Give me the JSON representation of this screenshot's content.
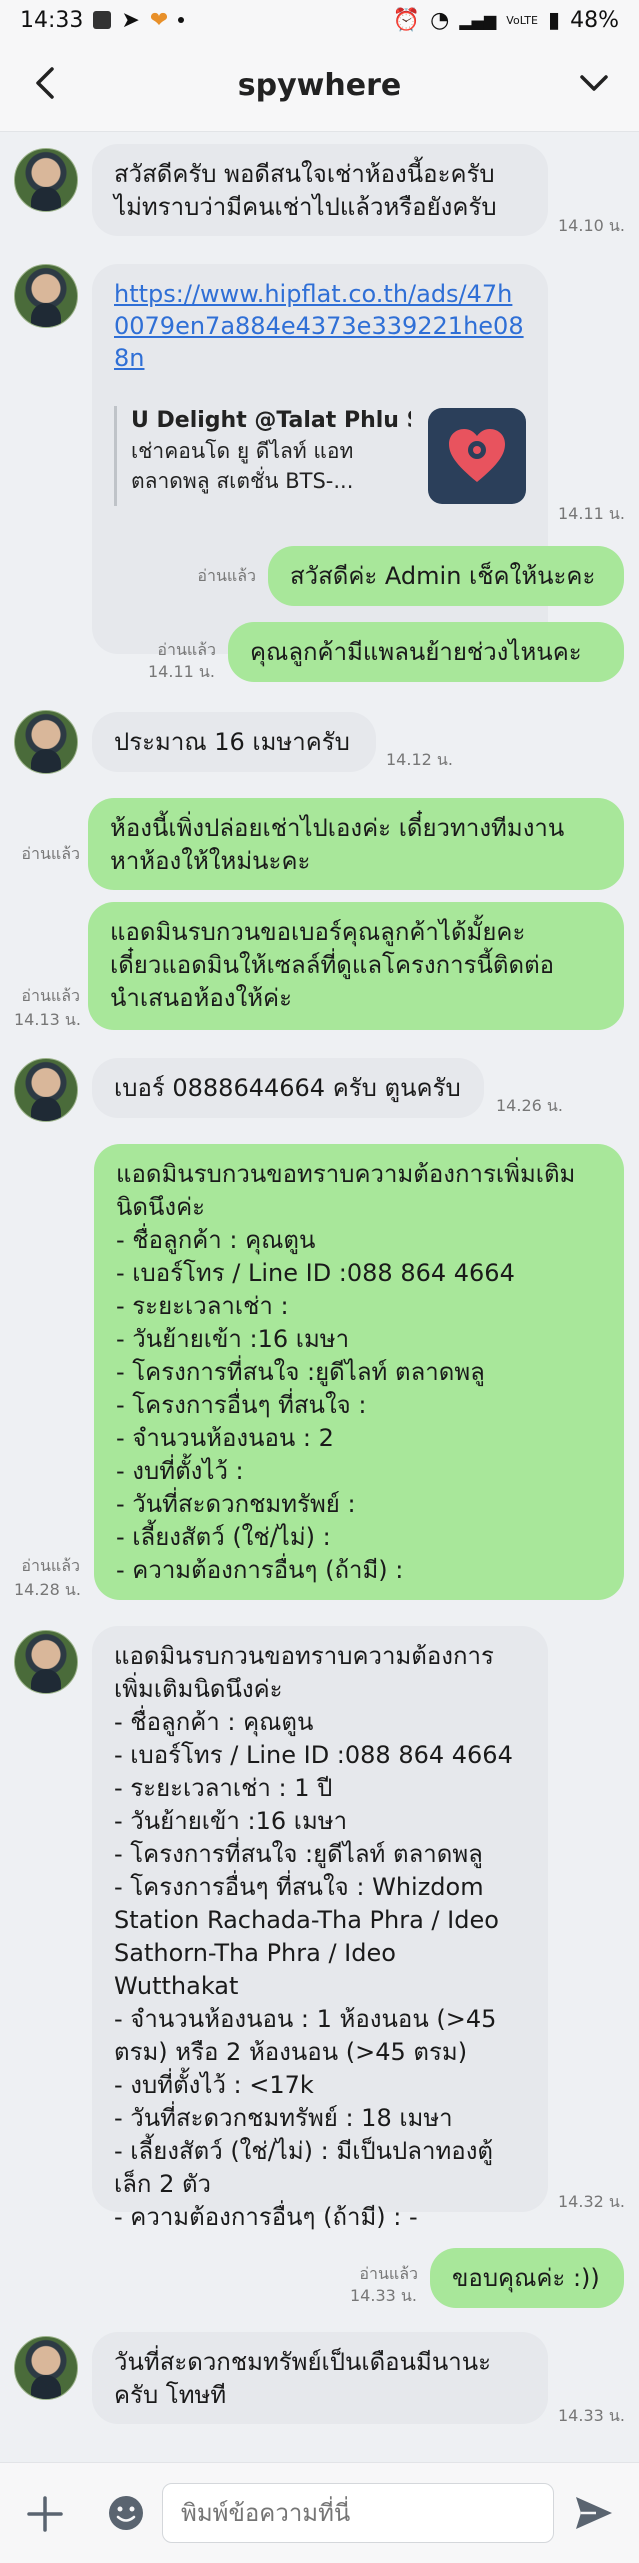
{
  "status_bar": {
    "time": "14:33",
    "battery": "48%",
    "network": "VoLTE"
  },
  "header": {
    "title": "spywhere"
  },
  "messages": [
    {
      "text": "สวัสดีครับ พอดีสนใจเช่าห้องนี้อะครับ\nไม่ทราบว่ามีคนเช่าไปแล้วหรือยังครับ",
      "time": "14.10 น."
    },
    {
      "url": "https://www.hipflat.co.th/ads/47h0079en7a884e4373e339221he088n",
      "preview_title": "U Delight @Talat Phlu St...",
      "preview_desc": "เช่าคอนโด ยู ดีไลท์ แอท\nตลาดพลู สเตชั่น BTS-...",
      "time": "14.11 น."
    },
    {
      "text": "สวัสดีค่ะ Admin เช็คให้นะคะ",
      "read": "อ่านแล้ว"
    },
    {
      "text": "คุณลูกค้ามีแพลนย้ายช่วงไหนคะ",
      "read": "อ่านแล้ว",
      "time": "14.11 น."
    },
    {
      "text": "ประมาณ 16 เมษาครับ",
      "time": "14.12 น."
    },
    {
      "text": "ห้องนี้เพิ่งปล่อยเช่าไปเองค่ะ เดี๋ยวทางทีมงาน\nหาห้องให้ใหม่นะคะ",
      "read": "อ่านแล้ว"
    },
    {
      "text": "แอดมินรบกวนขอเบอร์คุณลูกค้าได้มั้ยคะ\nเดี๋ยวแอดมินให้เซลล์ที่ดูแลโครงการนี้ติดต่อ\nนำเสนอห้องให้ค่ะ",
      "read": "อ่านแล้ว",
      "time": "14.13 น."
    },
    {
      "text": "เบอร์ 0888644664 ครับ ตูนครับ",
      "time": "14.26 น."
    },
    {
      "text": "แอดมินรบกวนขอทราบความต้องการเพิ่มเติม\nนิดนึงค่ะ\n- ชื่อลูกค้า : คุณตูน\n- เบอร์โทร / Line ID :088 864 4664\n- ระยะเวลาเช่า :\n- วันย้ายเข้า :16 เมษา\n- โครงการที่สนใจ :ยูดีไลท์ ตลาดพลู\n- โครงการอื่นๆ ที่สนใจ :\n- จำนวนห้องนอน : 2\n- งบที่ตั้งไว้ :\n- วันที่สะดวกชมทรัพย์ :\n- เลี้ยงสัตว์ (ใช่/ไม่) :\n- ความต้องการอื่นๆ (ถ้ามี) :",
      "read": "อ่านแล้ว",
      "time": "14.28 น."
    },
    {
      "text": "แอดมินรบกวนขอทราบความต้องการ\nเพิ่มเติมนิดนึงค่ะ\n- ชื่อลูกค้า : คุณตูน\n- เบอร์โทร / Line ID :088 864 4664\n- ระยะเวลาเช่า : 1 ปี\n- วันย้ายเข้า :16 เมษา\n- โครงการที่สนใจ :ยูดีไลท์ ตลาดพลู\n- โครงการอื่นๆ ที่สนใจ : Whizdom\nStation Rachada-Tha Phra / Ideo\nSathorn-Tha Phra / Ideo Wutthakat\n- จำนวนห้องนอน : 1 ห้องนอน (>45\nตรม) หรือ 2 ห้องนอน (>45 ตรม)\n- งบที่ตั้งไว้ : <17k\n- วันที่สะดวกชมทรัพย์ : 18 เมษา\n- เลี้ยงสัตว์ (ใช่/ไม่) : มีเป็นปลาทองตู้\nเล็ก 2 ตัว\n- ความต้องการอื่นๆ (ถ้ามี) : -",
      "time": "14.32 น."
    },
    {
      "text": "ขอบคุณค่ะ :))",
      "read": "อ่านแล้ว",
      "time": "14.33 น."
    },
    {
      "text": "วันที่สะดวกชมทรัพย์เป็นเดือนมีนานะ\nครับ โทษที",
      "time": "14.33 น."
    }
  ],
  "input": {
    "placeholder": "พิมพ์ข้อความที่นี่"
  },
  "colors": {
    "outgoing_bubble": "#a8e79a",
    "incoming_bubble": "#e6e8ec",
    "link": "#2f6fd6"
  }
}
